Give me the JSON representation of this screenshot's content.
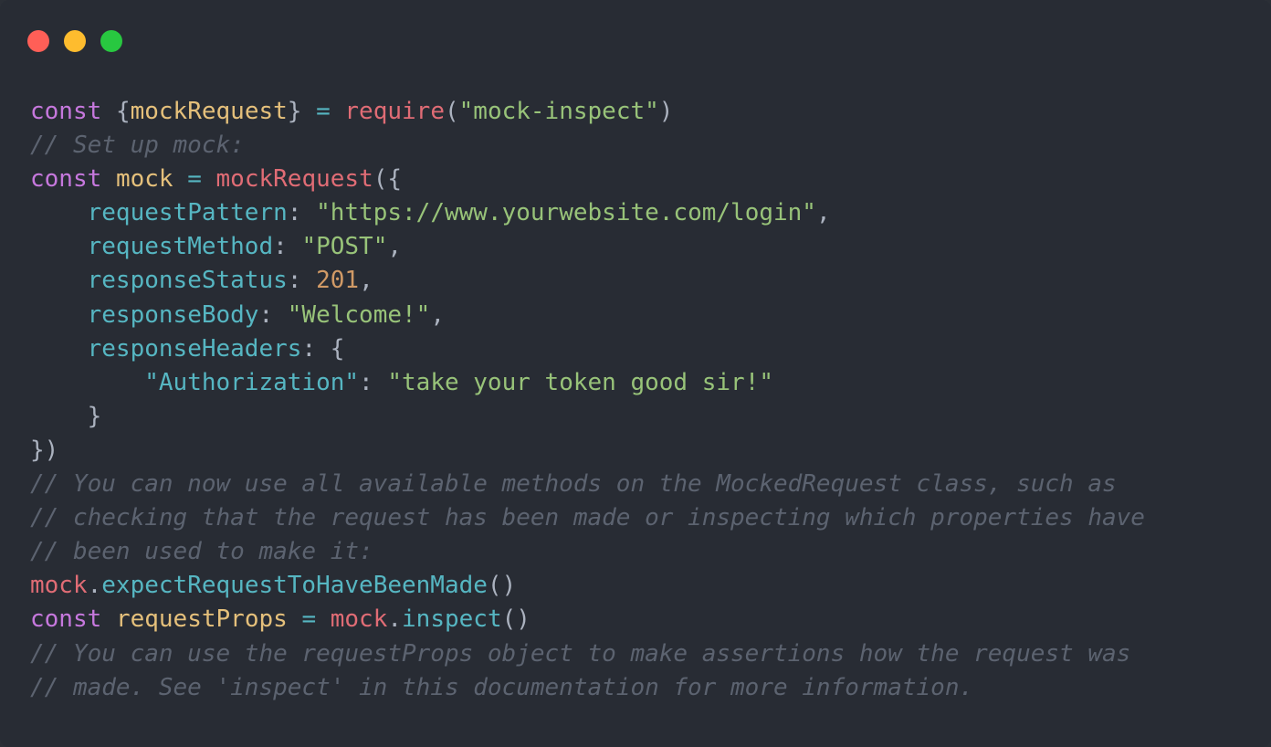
{
  "window": {
    "controls": [
      {
        "name": "close",
        "color": "#ff5f57"
      },
      {
        "name": "minimize",
        "color": "#febc2e"
      },
      {
        "name": "maximize",
        "color": "#28c840"
      }
    ]
  },
  "code": {
    "lines": [
      [
        [
          "keyword",
          "const"
        ],
        [
          "plain",
          " "
        ],
        [
          "punct",
          "{"
        ],
        [
          "var",
          "mockRequest"
        ],
        [
          "punct",
          "}"
        ],
        [
          "plain",
          " "
        ],
        [
          "op",
          "="
        ],
        [
          "plain",
          " "
        ],
        [
          "func",
          "require"
        ],
        [
          "punct",
          "("
        ],
        [
          "string",
          "\"mock-inspect\""
        ],
        [
          "punct",
          ")"
        ]
      ],
      [
        [
          "comment",
          "// Set up mock:"
        ]
      ],
      [
        [
          "keyword",
          "const"
        ],
        [
          "plain",
          " "
        ],
        [
          "var",
          "mock"
        ],
        [
          "plain",
          " "
        ],
        [
          "op",
          "="
        ],
        [
          "plain",
          " "
        ],
        [
          "func",
          "mockRequest"
        ],
        [
          "punct",
          "({"
        ]
      ],
      [
        [
          "plain",
          "    "
        ],
        [
          "prop",
          "requestPattern"
        ],
        [
          "punct",
          ": "
        ],
        [
          "string",
          "\"https://www.yourwebsite.com/login\""
        ],
        [
          "punct",
          ","
        ]
      ],
      [
        [
          "plain",
          "    "
        ],
        [
          "prop",
          "requestMethod"
        ],
        [
          "punct",
          ": "
        ],
        [
          "string",
          "\"POST\""
        ],
        [
          "punct",
          ","
        ]
      ],
      [
        [
          "plain",
          "    "
        ],
        [
          "prop",
          "responseStatus"
        ],
        [
          "punct",
          ": "
        ],
        [
          "number",
          "201"
        ],
        [
          "punct",
          ","
        ]
      ],
      [
        [
          "plain",
          "    "
        ],
        [
          "prop",
          "responseBody"
        ],
        [
          "punct",
          ": "
        ],
        [
          "string",
          "\"Welcome!\""
        ],
        [
          "punct",
          ","
        ]
      ],
      [
        [
          "plain",
          "    "
        ],
        [
          "prop",
          "responseHeaders"
        ],
        [
          "punct",
          ": {"
        ]
      ],
      [
        [
          "plain",
          "        "
        ],
        [
          "prop",
          "\"Authorization\""
        ],
        [
          "punct",
          ": "
        ],
        [
          "string",
          "\"take your token good sir!\""
        ]
      ],
      [
        [
          "plain",
          "    "
        ],
        [
          "punct",
          "}"
        ]
      ],
      [
        [
          "punct",
          "})"
        ]
      ],
      [
        [
          "comment",
          "// You can now use all available methods on the MockedRequest class, such as"
        ]
      ],
      [
        [
          "comment",
          "// checking that the request has been made or inspecting which properties have"
        ]
      ],
      [
        [
          "comment",
          "// been used to make it:"
        ]
      ],
      [
        [
          "func",
          "mock"
        ],
        [
          "punct",
          "."
        ],
        [
          "prop",
          "expectRequestToHaveBeenMade"
        ],
        [
          "punct",
          "()"
        ]
      ],
      [
        [
          "keyword",
          "const"
        ],
        [
          "plain",
          " "
        ],
        [
          "var",
          "requestProps"
        ],
        [
          "plain",
          " "
        ],
        [
          "op",
          "="
        ],
        [
          "plain",
          " "
        ],
        [
          "func",
          "mock"
        ],
        [
          "punct",
          "."
        ],
        [
          "prop",
          "inspect"
        ],
        [
          "punct",
          "()"
        ]
      ],
      [
        [
          "comment",
          "// You can use the requestProps object to make assertions how the request was"
        ]
      ],
      [
        [
          "comment",
          "// made. See 'inspect' in this documentation for more information."
        ]
      ]
    ]
  }
}
